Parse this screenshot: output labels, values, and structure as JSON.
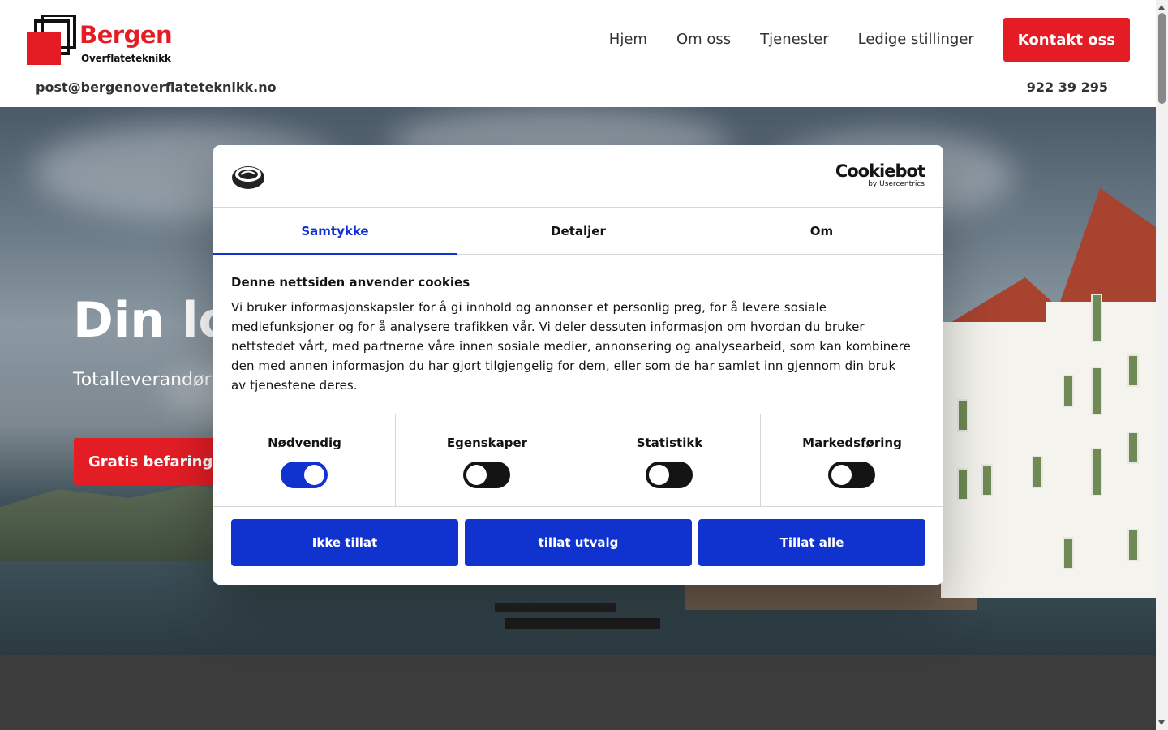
{
  "brand": {
    "name": "Bergen",
    "tagline": "Overflateteknikk",
    "accent_color": "#e41d25"
  },
  "nav": {
    "items": [
      {
        "label": "Hjem"
      },
      {
        "label": "Om oss"
      },
      {
        "label": "Tjenester"
      },
      {
        "label": "Ledige stillinger"
      }
    ],
    "cta_label": "Kontakt oss"
  },
  "contact": {
    "email": "post@bergenoverflateteknikk.no",
    "phone": "922 39 295"
  },
  "hero": {
    "title_visible": "Din lok",
    "subtitle_visible": "Totalleverandør",
    "cta_label": "Gratis befaring"
  },
  "cookie_dialog": {
    "provider_name": "Cookiebot",
    "provider_by": "by Usercentrics",
    "accent_color": "#1032cf",
    "tabs": [
      {
        "label": "Samtykke",
        "active": true
      },
      {
        "label": "Detaljer",
        "active": false
      },
      {
        "label": "Om",
        "active": false
      }
    ],
    "title": "Denne nettsiden anvender cookies",
    "body": "Vi bruker informasjonskapsler for å gi innhold og annonser et personlig preg, for å levere sosiale mediefunksjoner og for å analysere trafikken vår. Vi deler dessuten informasjon om hvordan du bruker nettstedet vårt, med partnerne våre innen sosiale medier, annonsering og analysearbeid, som kan kombinere den med annen informasjon du har gjort tilgjengelig for dem, eller som de har samlet inn gjennom din bruk av tjenestene deres.",
    "toggles": [
      {
        "label": "Nødvendig",
        "checked": true
      },
      {
        "label": "Egenskaper",
        "checked": false
      },
      {
        "label": "Statistikk",
        "checked": false
      },
      {
        "label": "Markedsføring",
        "checked": false
      }
    ],
    "buttons": {
      "deny": "Ikke tillat",
      "allow_selection": "tillat utvalg",
      "allow_all": "Tillat alle"
    }
  }
}
